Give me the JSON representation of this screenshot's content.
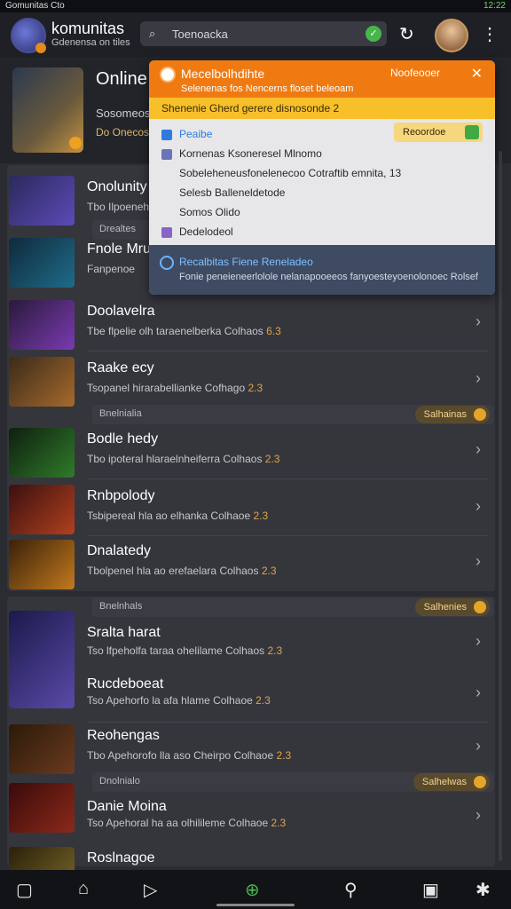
{
  "status": {
    "left": "Gomunitas Cto",
    "right": "12:22"
  },
  "header": {
    "brand": "komunitas",
    "brand_sub": "Gdenensa on tiles",
    "search_placeholder": "Toenoacka"
  },
  "hero": {
    "title": "Online",
    "line1": "Sosomeoso",
    "line2": "Do Onecos"
  },
  "sections": [
    {
      "rows": [
        {
          "title": "Onolunity",
          "sub": "Tbo Ilpoenehe",
          "thumb": "#5c4ab8"
        },
        {
          "title": "Fnole Mru",
          "sub": "Fanpenoe",
          "thumb": "#1f6b8a"
        },
        {
          "title": "Doolavelra",
          "sub": "Tbe flpelie olh taraenelberka Colhaos",
          "num": "6.3",
          "thumb": "#7a3ab2"
        },
        {
          "title": "Raake ecy",
          "sub": "Tsopanel hirarabellianke Cofhago",
          "num": "2.3",
          "thumb": "#a66a2c"
        }
      ]
    },
    {
      "rows": [
        {
          "title": "Bodle hedy",
          "sub": "Tbo ipoteral hlaraelnheiferra Colhaos",
          "num": "2.3",
          "thumb": "#2f7b2a"
        },
        {
          "title": "Rnbpolody",
          "sub": "Tsbipereal hla ao elhanka Colhaoe",
          "num": "2.3",
          "thumb": "#b1401e"
        },
        {
          "title": "Dnalatedy",
          "sub": "Tbolpenel hla ao erefaelara Colhaos",
          "num": "2.3",
          "thumb": "#c27a1e"
        }
      ]
    },
    {
      "rows": [
        {
          "title": "Sralta harat",
          "sub": "Tso lfpeholfa taraa ohelilame Colhaos",
          "num": "2.3",
          "thumb": "#3a3a8a"
        },
        {
          "title": "Rucdeboeat",
          "sub": "Tso Apehorfo la afa hlame Colhaoe",
          "num": "2.3",
          "thumb": "#5a4a8a"
        },
        {
          "title": "Reohengas",
          "sub": "Tbo Apehorofo lla aso Cheirpo Colhaoe",
          "num": "2.3",
          "thumb": "#6b3a1e"
        },
        {
          "title": "Danie Moina",
          "sub": "Tso Apehoral ha aa olhilileme Colhaoe",
          "num": "2.3",
          "thumb": "#8a2a1a"
        },
        {
          "title": "Roslnagoe",
          "sub": "",
          "thumb": "#7a6a2a"
        }
      ]
    }
  ],
  "groups": [
    {
      "label": "Drealtes",
      "pill": ""
    },
    {
      "label": "Bnelnialia",
      "pill": "Salhainas"
    },
    {
      "label": "Bnelnhals",
      "pill": "Salhenies"
    },
    {
      "label": "Dnolnialo",
      "pill": "Salhelwas"
    }
  ],
  "popup": {
    "title": "Mecelbolhdihte",
    "subtitle": "Selenenas fos Nencerns floset beleoam",
    "notify": "Noofeooer",
    "banner": "Shenenie Gherd gerere disnosonde 2",
    "items": [
      {
        "label": "Peaibe",
        "color": "#2f7ae0"
      },
      {
        "label": "Kornenas Ksoneresel Mlnomo",
        "color": "#6a74b8"
      },
      {
        "label": "Sobeleheneusfonelenecoo Cotraftib emnita, 13",
        "color": ""
      },
      {
        "label": "Selesb Balleneldetode",
        "color": ""
      },
      {
        "label": "Somos Olido",
        "color": ""
      },
      {
        "label": "Dedelodeol",
        "color": "#8a63c9"
      }
    ],
    "rec_button": "Reoordoe",
    "footer_title": "Recalbitas Fiene Reneladeo",
    "footer_sub": "Fonie peneieneerlolole nelanapooeeos fanyoesteyoenolonoec Rolsef"
  }
}
